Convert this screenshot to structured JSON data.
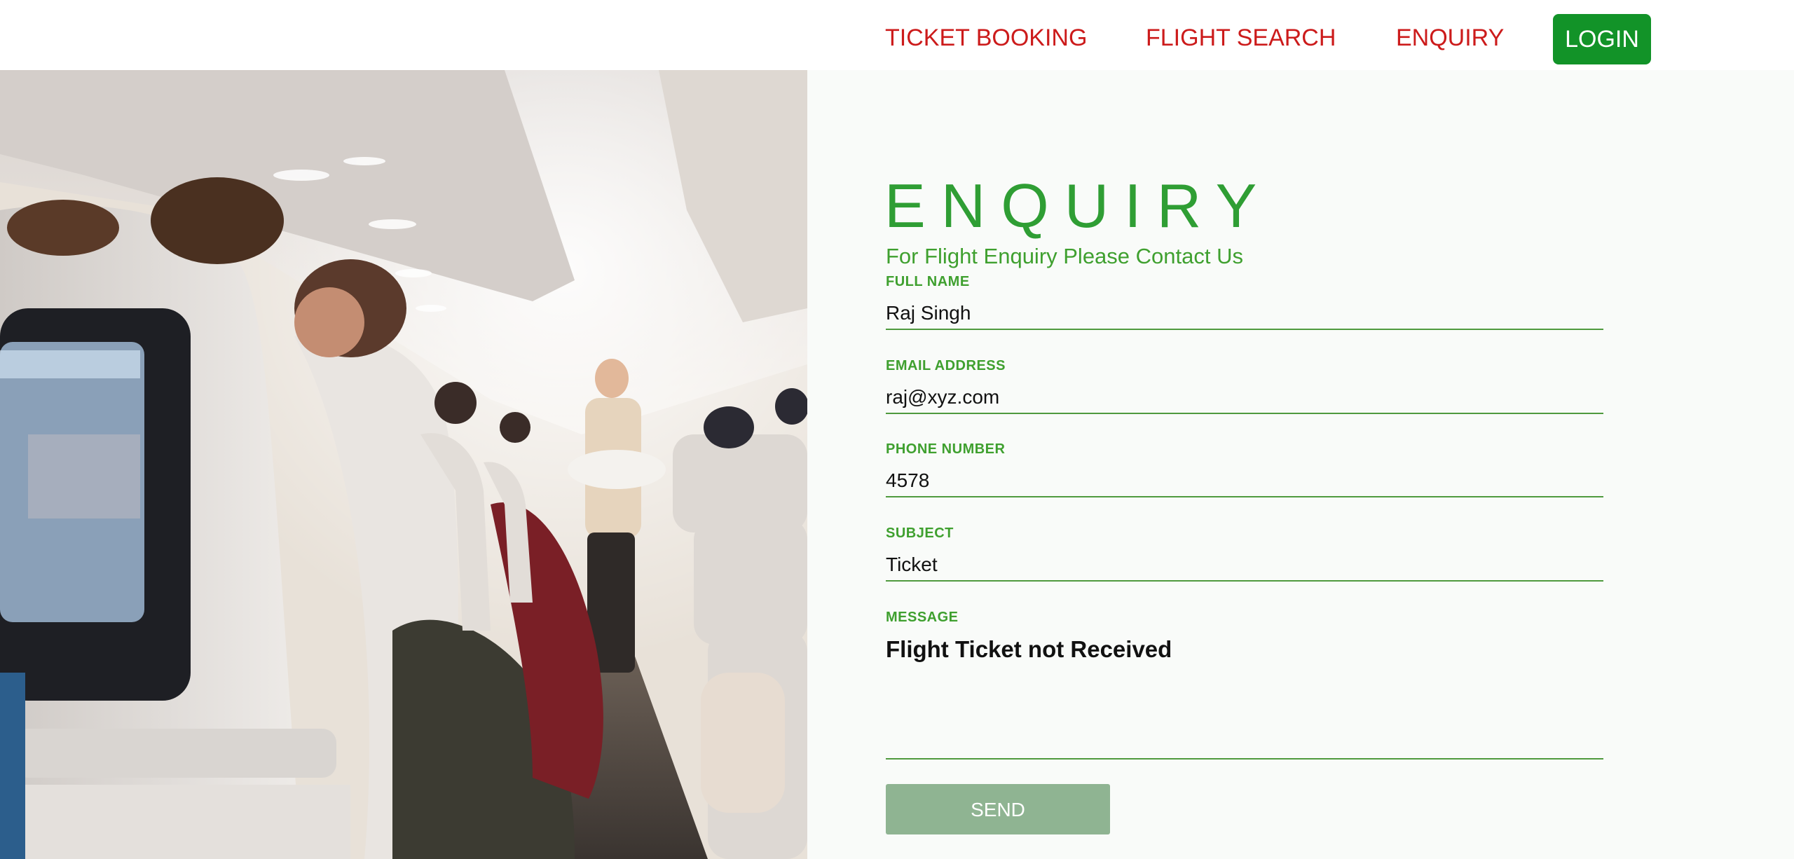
{
  "nav": {
    "items": [
      {
        "label": "TICKET BOOKING"
      },
      {
        "label": "FLIGHT SEARCH"
      },
      {
        "label": "ENQUIRY"
      }
    ],
    "login_label": "LOGIN"
  },
  "form": {
    "title": "ENQUIRY",
    "subtitle": "For Flight Enquiry Please Contact Us",
    "fields": [
      {
        "label": "FULL NAME",
        "value": "Raj Singh"
      },
      {
        "label": "EMAIL ADDRESS",
        "value": "raj@xyz.com"
      },
      {
        "label": "PHONE NUMBER",
        "value": "4578"
      },
      {
        "label": "SUBJECT",
        "value": "Ticket"
      }
    ],
    "message": {
      "label": "MESSAGE",
      "value": "Flight Ticket not Received"
    },
    "send_label": "SEND"
  },
  "colors": {
    "nav_link": "#cc1b1b",
    "login_bg": "#129328",
    "accent_green": "#3fa02f",
    "send_bg": "#8fb492"
  },
  "hero": {
    "icon": "airplane-cabin-photo"
  }
}
